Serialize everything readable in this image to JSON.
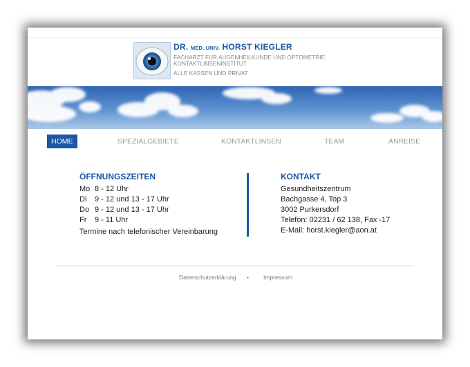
{
  "header": {
    "title_prefix": "DR.",
    "title_small": "MED. UNIV.",
    "title_name": "HORST KIEGLER",
    "line1": "FACHARZT FÜR AUGENHEILKUNDE UND OPTOMETRIE",
    "line2": "KONTAKTLINSENINSTITUT",
    "line3": "ALLE KASSEN UND PRIVAT",
    "logo_icon": "eye-icon"
  },
  "nav": {
    "items": [
      {
        "label": "HOME"
      },
      {
        "label": "SPEZIALGEBIETE"
      },
      {
        "label": "KONTAKTLINSEN"
      },
      {
        "label": "TEAM"
      },
      {
        "label": "ANREISE"
      }
    ],
    "active": "HOME"
  },
  "hours": {
    "heading": "ÖFFNUNGSZEITEN",
    "rows": [
      {
        "day": "Mo",
        "time": "8 - 12 Uhr"
      },
      {
        "day": "Di",
        "time": "9 - 12 und 13 - 17 Uhr"
      },
      {
        "day": "Do",
        "time": "9 - 12 und 13 - 17 Uhr"
      },
      {
        "day": "Fr",
        "time": "9 - 11 Uhr"
      }
    ],
    "note": "Termine nach telefonischer Vereinbarung"
  },
  "contact": {
    "heading": "KONTAKT",
    "lines": [
      "Gesundheitszentrum",
      "Bachgasse 4, Top 3",
      "3002 Purkersdorf",
      "Telefon: 02231 / 62 138, Fax -17",
      "E-Mail: horst.kiegler@aon.at"
    ]
  },
  "footer": {
    "privacy": "Datenschutzerklärung",
    "separator": "•",
    "imprint": "Impressum"
  },
  "colors": {
    "accent": "#1a57a5",
    "text": "#1e1e1e",
    "muted": "#9a9a9a"
  }
}
